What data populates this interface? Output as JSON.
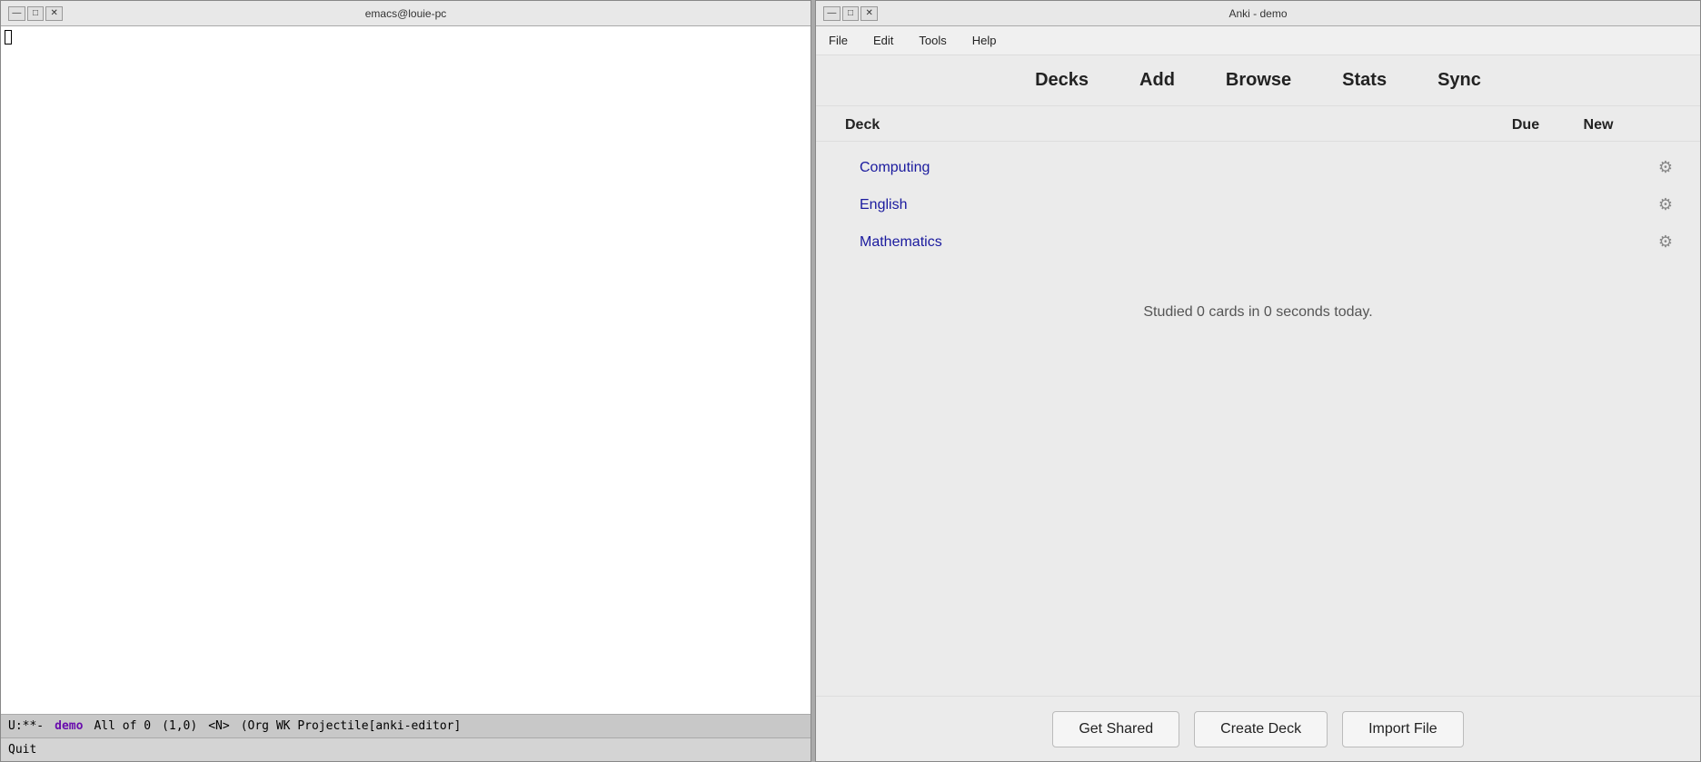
{
  "emacs": {
    "title": "emacs@louie-pc",
    "window_controls": {
      "minimize": "—",
      "maximize": "□",
      "close": "✕"
    },
    "modeline": {
      "mode_indicator": "U:**-",
      "buffer_name": "demo",
      "position": "All of 0",
      "coords": "(1,0)",
      "mode_n": "<N>",
      "mode_detail": "(Org WK Projectile[anki-editor]"
    },
    "echo_area": "Quit"
  },
  "anki": {
    "title": "Anki - demo",
    "window_controls": {
      "minimize": "—",
      "maximize": "□",
      "close": "✕"
    },
    "menu": {
      "file": "File",
      "edit": "Edit",
      "tools": "Tools",
      "help": "Help"
    },
    "toolbar": {
      "decks": "Decks",
      "add": "Add",
      "browse": "Browse",
      "stats": "Stats",
      "sync": "Sync"
    },
    "deck_list": {
      "column_deck": "Deck",
      "column_due": "Due",
      "column_new": "New",
      "decks": [
        {
          "name": "Computing",
          "due": "",
          "new": ""
        },
        {
          "name": "English",
          "due": "",
          "new": ""
        },
        {
          "name": "Mathematics",
          "due": "",
          "new": ""
        }
      ]
    },
    "studied_text": "Studied 0 cards in 0 seconds today.",
    "footer": {
      "get_shared": "Get Shared",
      "create_deck": "Create Deck",
      "import_file": "Import File"
    }
  }
}
